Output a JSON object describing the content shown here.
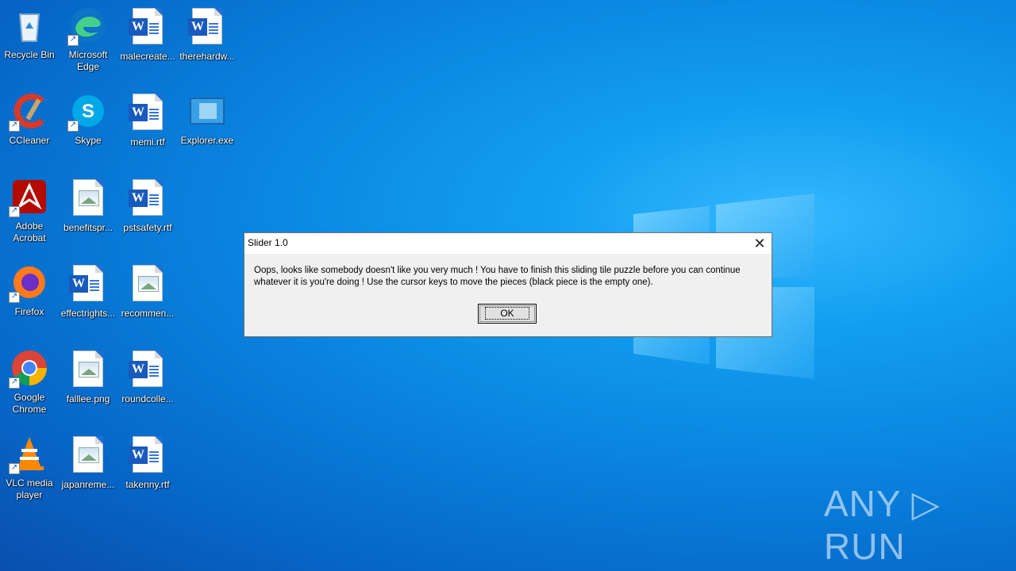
{
  "desktop": {
    "icons": [
      {
        "label": "Recycle Bin",
        "type": "recycle-bin"
      },
      {
        "label": "Microsoft Edge",
        "type": "edge"
      },
      {
        "label": "malecreate...",
        "type": "word"
      },
      {
        "label": "therehardw...",
        "type": "word"
      },
      {
        "label": "CCleaner",
        "type": "ccleaner"
      },
      {
        "label": "Skype",
        "type": "skype"
      },
      {
        "label": "memi.rtf",
        "type": "word"
      },
      {
        "label": "Explorer.exe",
        "type": "exe"
      },
      {
        "label": "Adobe Acrobat",
        "type": "acrobat"
      },
      {
        "label": "benefitspr...",
        "type": "image"
      },
      {
        "label": "pstsafety.rtf",
        "type": "word"
      },
      {
        "label": "Firefox",
        "type": "firefox"
      },
      {
        "label": "effectrights...",
        "type": "word"
      },
      {
        "label": "recommen...",
        "type": "image"
      },
      {
        "label": "Google Chrome",
        "type": "chrome"
      },
      {
        "label": "falllee.png",
        "type": "image"
      },
      {
        "label": "roundcolle...",
        "type": "word"
      },
      {
        "label": "VLC media player",
        "type": "vlc"
      },
      {
        "label": "japanreme...",
        "type": "image"
      },
      {
        "label": "takenny.rtf",
        "type": "word"
      }
    ]
  },
  "dialog": {
    "title": "Slider 1.0",
    "message": "Oops, looks like somebody doesn't like you very much ! You have to finish this sliding tile puzzle before you can continue whatever it is you're doing ! Use the cursor keys to move the pieces (black piece is the empty one).",
    "ok_label": "OK",
    "close_glyph": "✕"
  },
  "watermark": "ANY ▷ RUN"
}
